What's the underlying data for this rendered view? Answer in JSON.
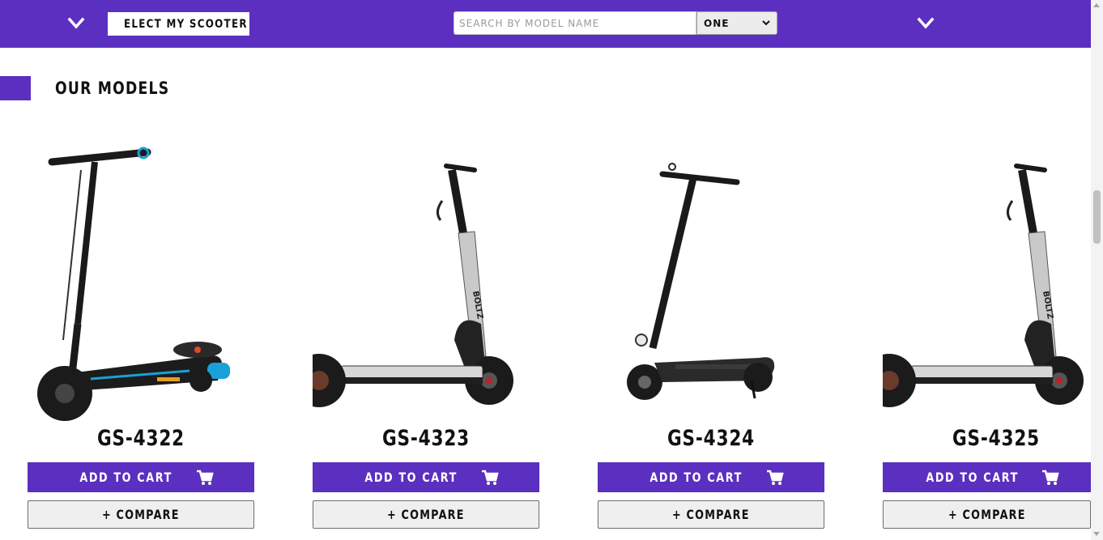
{
  "header": {
    "left_icon": "chevron-down-icon",
    "select_label": "ELECT MY SCOOTER",
    "select_icon": "chevron-down-icon",
    "search_placeholder": "SEARCH BY MODEL NAME",
    "dropdown_value": "ONE",
    "right_icon": "chevron-down-icon",
    "bar_color": "#5b2fbf"
  },
  "section": {
    "title": "OUR MODELS",
    "accent_color": "#5b2fbf"
  },
  "products": [
    {
      "model": "GS-4322",
      "cart_label": "ADD TO CART",
      "compare_label": "+ COMPARE",
      "image": "kids-electric-scooter-image"
    },
    {
      "model": "GS-4323",
      "cart_label": "ADD TO CART",
      "compare_label": "+ COMPARE",
      "image": "boltz-electric-scooter-image"
    },
    {
      "model": "GS-4324",
      "cart_label": "ADD TO CART",
      "compare_label": "+ COMPARE",
      "image": "black-electric-scooter-image"
    },
    {
      "model": "GS-4325",
      "cart_label": "ADD TO CART",
      "compare_label": "+ COMPARE",
      "image": "boltz-electric-scooter-image"
    }
  ],
  "icons": {
    "cart": "shopping-cart-icon"
  }
}
